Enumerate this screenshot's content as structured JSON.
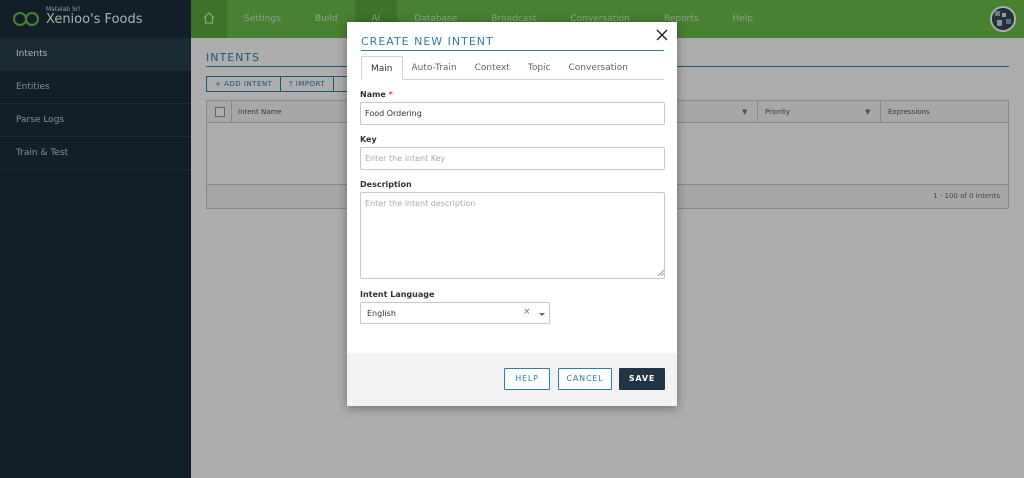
{
  "header": {
    "company": "Matelab Srl",
    "app_name": "Xenioo's Foods",
    "nav": [
      "Settings",
      "Build",
      "AI",
      "Database",
      "Broadcast",
      "Conversation",
      "Reports",
      "Help"
    ],
    "active_nav": "AI",
    "accent_color": "#6abf4b"
  },
  "sidebar": {
    "items": [
      {
        "label": "Intents"
      },
      {
        "label": "Entities"
      },
      {
        "label": "Parse Logs"
      },
      {
        "label": "Train & Test"
      }
    ]
  },
  "main": {
    "title": "INTENTS",
    "toolbar": {
      "add": "+ ADD INTENT",
      "import": "⤒ IMPORT"
    },
    "columns": [
      "Intent Name",
      "Priority",
      "Expressions"
    ],
    "footer": "1 - 100 of 0 intents"
  },
  "modal": {
    "title": "CREATE NEW INTENT",
    "tabs": [
      "Main",
      "Auto-Train",
      "Context",
      "Topic",
      "Conversation"
    ],
    "active_tab": "Main",
    "name": {
      "label": "Name",
      "required_mark": "*",
      "value": "Food Ordering"
    },
    "key": {
      "label": "Key",
      "placeholder": "Enter the intent Key"
    },
    "description": {
      "label": "Description",
      "placeholder": "Enter the intent description"
    },
    "language": {
      "label": "Intent Language",
      "value": "English",
      "clear": "×"
    },
    "buttons": {
      "help": "HELP",
      "cancel": "CANCEL",
      "save": "SAVE"
    }
  }
}
